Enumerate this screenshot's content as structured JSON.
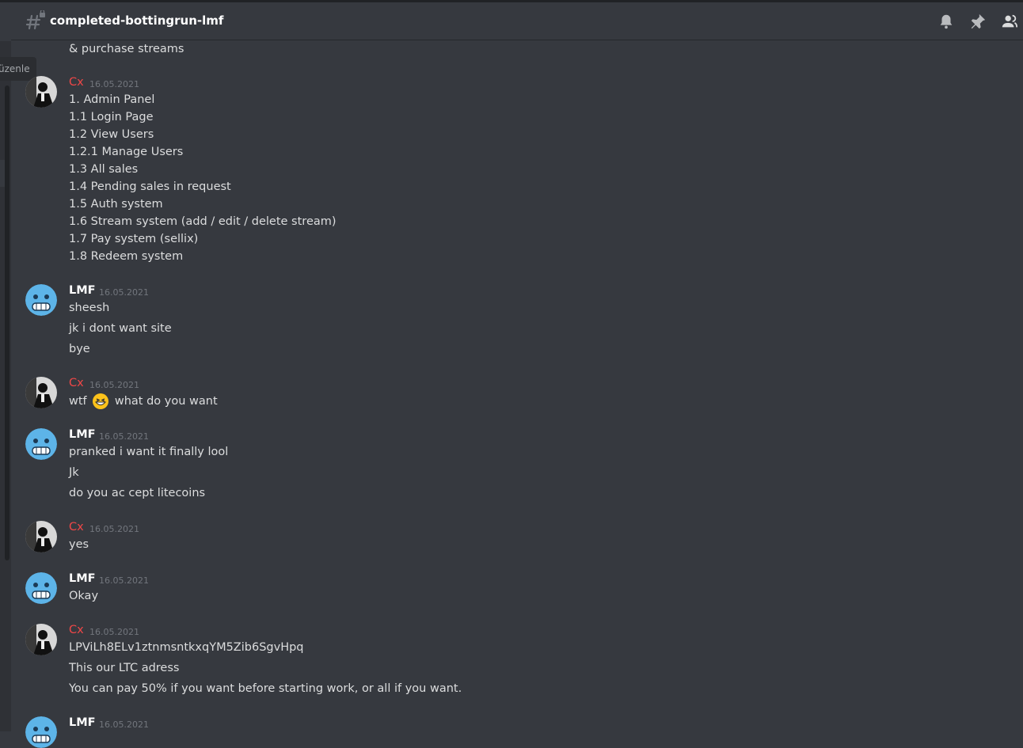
{
  "tooltip": "üzenle",
  "header": {
    "channel_name": "completed-bottingrun-lmf"
  },
  "icons": [
    "hashtag-lock-icon",
    "bell-icon",
    "pin-icon",
    "members-icon"
  ],
  "colors": {
    "background": "#36393f",
    "cx_name": "#f04747",
    "lmf_name": "#ffffff",
    "timestamp": "#72767d"
  },
  "messages": {
    "top_line": "& purchase streams",
    "g1": {
      "author": "Cx",
      "time": "16.05.2021",
      "lines": [
        "1. Admin Panel",
        "1.1 Login Page",
        "1.2 View Users",
        "1.2.1 Manage Users",
        "1.3 All sales",
        "1.4 Pending sales in request",
        "1.5 Auth system",
        "1.6 Stream system (add / edit / delete stream)",
        "1.7 Pay system (sellix)",
        "1.8 Redeem system"
      ]
    },
    "g2": {
      "author": "LMF",
      "time": "16.05.2021",
      "lines": [
        "sheesh",
        "jk i dont want site",
        "bye"
      ]
    },
    "g3": {
      "author": "Cx",
      "time": "16.05.2021",
      "before": "wtf",
      "after": "what do you want"
    },
    "g4": {
      "author": "LMF",
      "time": "16.05.2021",
      "lines": [
        "pranked i want it finally lool",
        "Jk",
        "do you ac cept litecoins"
      ]
    },
    "g5": {
      "author": "Cx",
      "time": "16.05.2021",
      "lines": [
        "yes"
      ]
    },
    "g6": {
      "author": "LMF",
      "time": "16.05.2021",
      "lines": [
        "Okay"
      ]
    },
    "g7": {
      "author": "Cx",
      "time": "16.05.2021",
      "lines": [
        "LPViLh8ELv1ztnmsntkxqYM5Zib6SgvHpq",
        "This our LTC adress",
        "You can pay 50% if you want before starting work, or all if you want."
      ]
    },
    "g8": {
      "author": "LMF",
      "time": "16.05.2021"
    }
  }
}
